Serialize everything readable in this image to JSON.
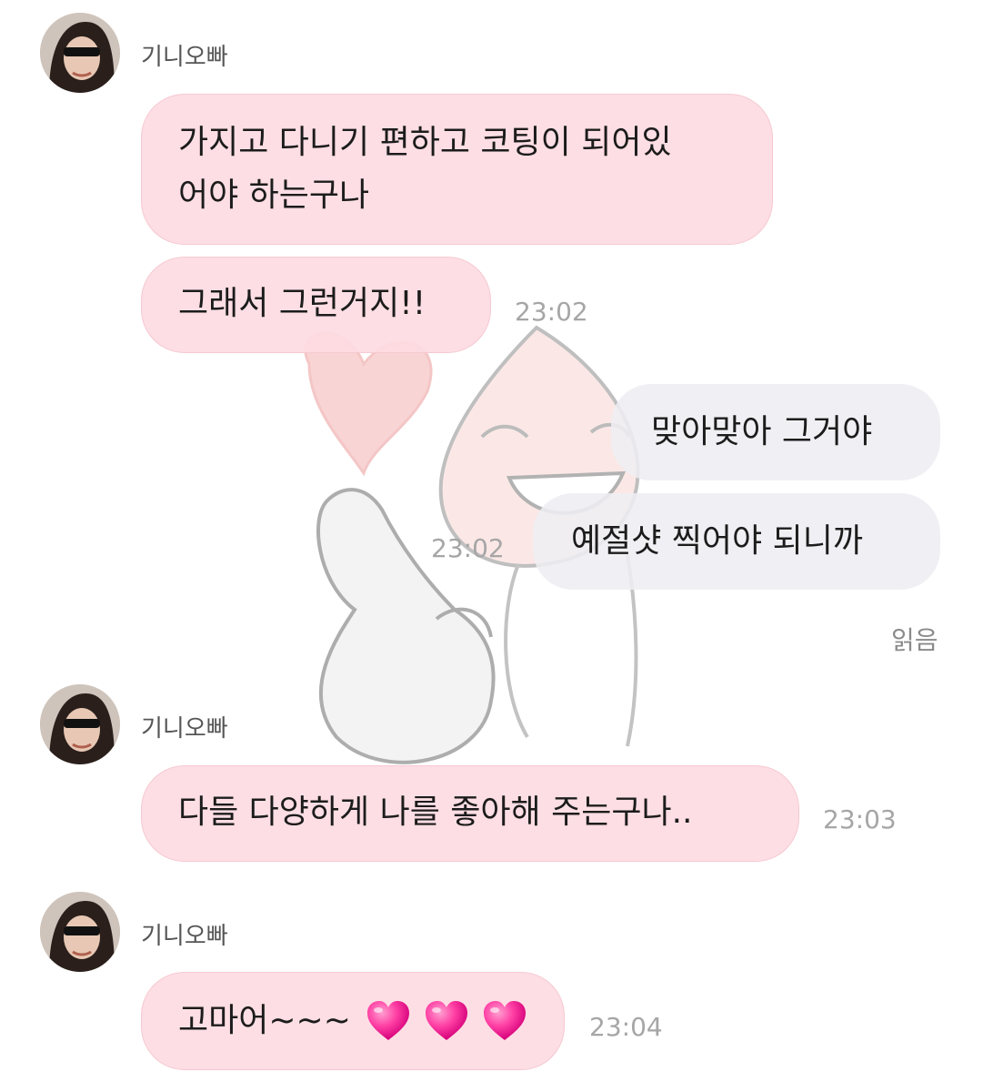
{
  "sender_name": "기니오빠",
  "messages": {
    "m1": {
      "lines": [
        "가지고 다니기 편하고 코팅이 되어있",
        "어야 하는구나"
      ]
    },
    "m2": {
      "text": "그래서 그런거지!!",
      "time": "23:02"
    },
    "m3": {
      "text": "맞아맞아 그거야"
    },
    "m4": {
      "text": "예절샷 찍어야 되니까",
      "time": "23:02"
    },
    "read_label": "읽음",
    "m5": {
      "text": "다들 다양하게 나를 좋아해 주는구나..",
      "time": "23:03"
    },
    "m6": {
      "text": "고마어~~~",
      "time": "23:04",
      "emoji": [
        "heart-icon",
        "heart-icon",
        "heart-icon"
      ]
    }
  },
  "colors": {
    "incoming_bubble": "#fddce2",
    "outgoing_bubble": "#eeeef2",
    "timestamp": "#a6a6a6",
    "heart": "#ff3fa4"
  }
}
